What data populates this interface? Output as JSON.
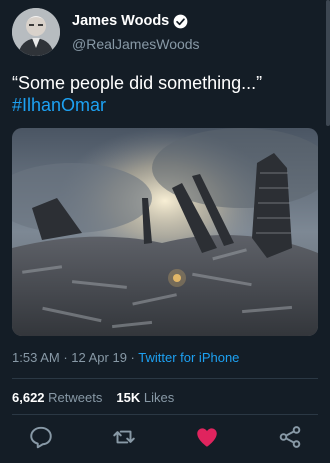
{
  "author": {
    "name": "James Woods",
    "handle": "@RealJamesWoods",
    "verified_icon": "verified-badge-icon"
  },
  "tweet": {
    "text": "“Some people did something...”",
    "hashtag": "#IlhanOmar"
  },
  "meta": {
    "time": "1:53 AM",
    "separator": " · ",
    "date": "12 Apr 19",
    "source": "Twitter for iPhone"
  },
  "stats": {
    "retweets_count": "6,622",
    "retweets_label": "Retweets",
    "likes_count": "15K",
    "likes_label": "Likes"
  },
  "actions": {
    "reply_icon": "reply-icon",
    "retweet_icon": "retweet-icon",
    "like_icon": "heart-icon",
    "share_icon": "share-icon"
  },
  "colors": {
    "background": "#141d26",
    "accent": "#1da1f2",
    "like": "#e0245e",
    "secondary_text": "#8899a6"
  }
}
